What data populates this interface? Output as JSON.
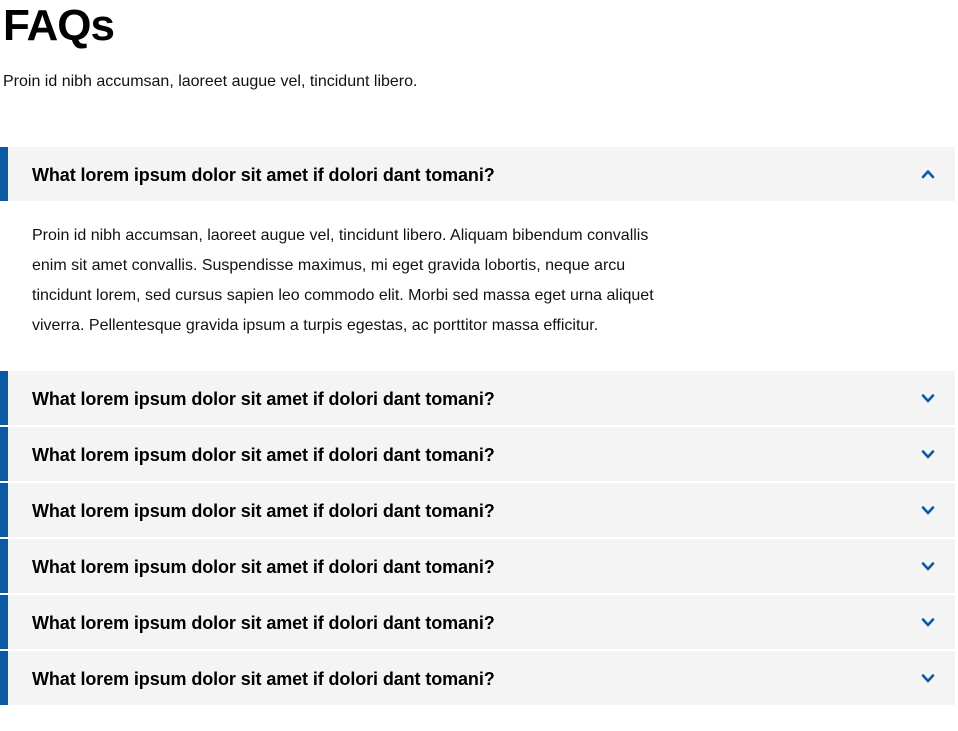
{
  "page": {
    "title": "FAQs",
    "intro": "Proin id nibh accumsan, laoreet augue vel, tincidunt libero."
  },
  "colors": {
    "accent": "#0b5aa3",
    "header_bg": "#f4f4f4"
  },
  "faqs": [
    {
      "question": "What lorem ipsum dolor sit amet if dolori dant tomani?",
      "answer": "Proin id nibh accumsan, laoreet augue vel, tincidunt libero. Aliquam bibendum convallis enim sit amet convallis. Suspendisse maximus, mi eget gravida lobortis, neque arcu tincidunt lorem, sed cursus sapien leo commodo elit. Morbi sed massa eget urna aliquet viverra. Pellentesque gravida ipsum a turpis egestas, ac porttitor massa efficitur.",
      "expanded": true,
      "icon": "chevron-up-icon"
    },
    {
      "question": "What lorem ipsum dolor sit amet if dolori dant tomani?",
      "expanded": false,
      "icon": "chevron-down-icon"
    },
    {
      "question": "What lorem ipsum dolor sit amet if dolori dant tomani?",
      "expanded": false,
      "icon": "chevron-down-icon"
    },
    {
      "question": "What lorem ipsum dolor sit amet if dolori dant tomani?",
      "expanded": false,
      "icon": "chevron-down-icon"
    },
    {
      "question": "What lorem ipsum dolor sit amet if dolori dant tomani?",
      "expanded": false,
      "icon": "chevron-down-icon"
    },
    {
      "question": "What lorem ipsum dolor sit amet if dolori dant tomani?",
      "expanded": false,
      "icon": "chevron-down-icon"
    },
    {
      "question": "What lorem ipsum dolor sit amet if dolori dant tomani?",
      "expanded": false,
      "icon": "chevron-down-icon"
    }
  ]
}
